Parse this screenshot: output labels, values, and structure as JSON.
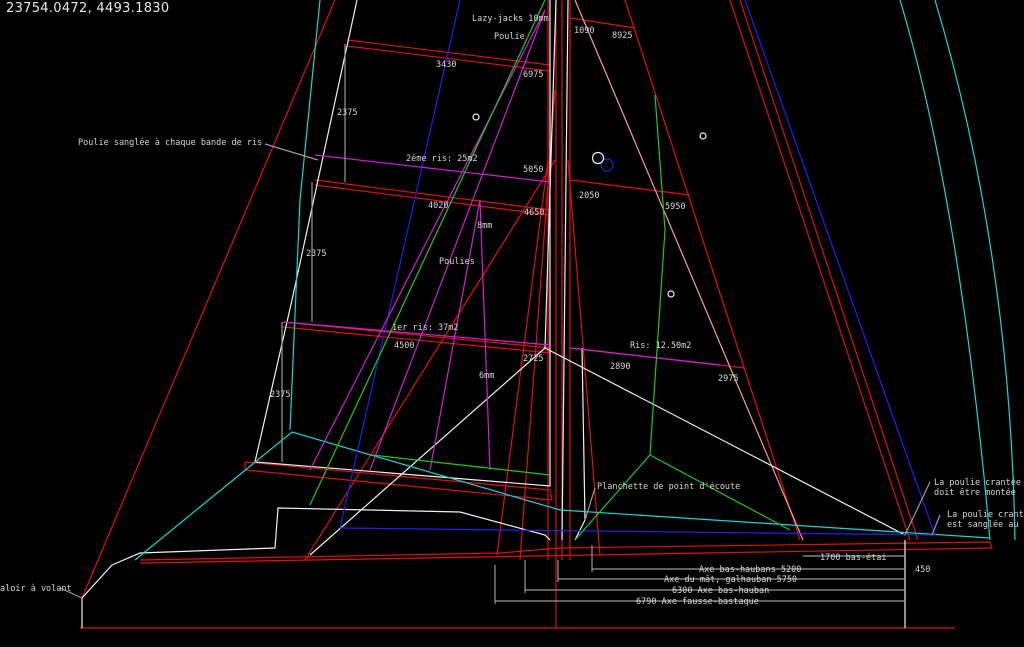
{
  "status": {
    "coordinates": "23754.0472,  4493.1830"
  },
  "labels": {
    "lazy_jacks": "Lazy-jacks 10mm",
    "poulie": "Poulie",
    "dim_1090": "1090",
    "dim_8925": "8925",
    "dim_3430": "3430",
    "dim_6975": "6975",
    "dim_2375_a": "2375",
    "poulie_sanglee": "Poulie sanglée à chaque bande de ris",
    "ris2": "2ème ris: 25m2",
    "dim_5050": "5050",
    "dim_2050": "2050",
    "dim_5950": "5950",
    "dim_4020": "4020",
    "dim_4650": "4650",
    "dim_8mm": "8mm",
    "dim_2375_b": "2375",
    "poulies": "Poulies",
    "ris1": "1er ris: 37m2",
    "dim_4500": "4500",
    "ris_foc": "Ris: 12.50m2",
    "dim_2725": "2725",
    "dim_2890": "2890",
    "dim_2975": "2975",
    "dim_6mm": "6mm",
    "dim_2375_c": "2375",
    "planchette": "Planchette de point d'écoute",
    "poulie_crantee_1": "La poulie crantée",
    "doit_etre": "doit être montée",
    "poulie_crantee_2": "La poulie crantée",
    "est_sanglee": "est sanglée au",
    "bas_etai": "1700 bas-étai",
    "dim_450": "450",
    "axe_bas_haubans": "Axe bas-haubans 5200",
    "axe_mat": "Axe du mât, galhauban 5750",
    "axe_bas_hauban": "6300 Axe bas-hauban",
    "axe_fausse": "6790 Axe fausse-bastaque",
    "avaloir": "aloir à volant"
  },
  "colors": {
    "red": "#e01010",
    "white": "#f0f0f0",
    "cyan": "#17d6d6",
    "blue": "#2020e8",
    "magenta": "#d020d0",
    "green": "#20c820",
    "grey": "#9a9a9a",
    "pink": "#ff9a9a"
  }
}
